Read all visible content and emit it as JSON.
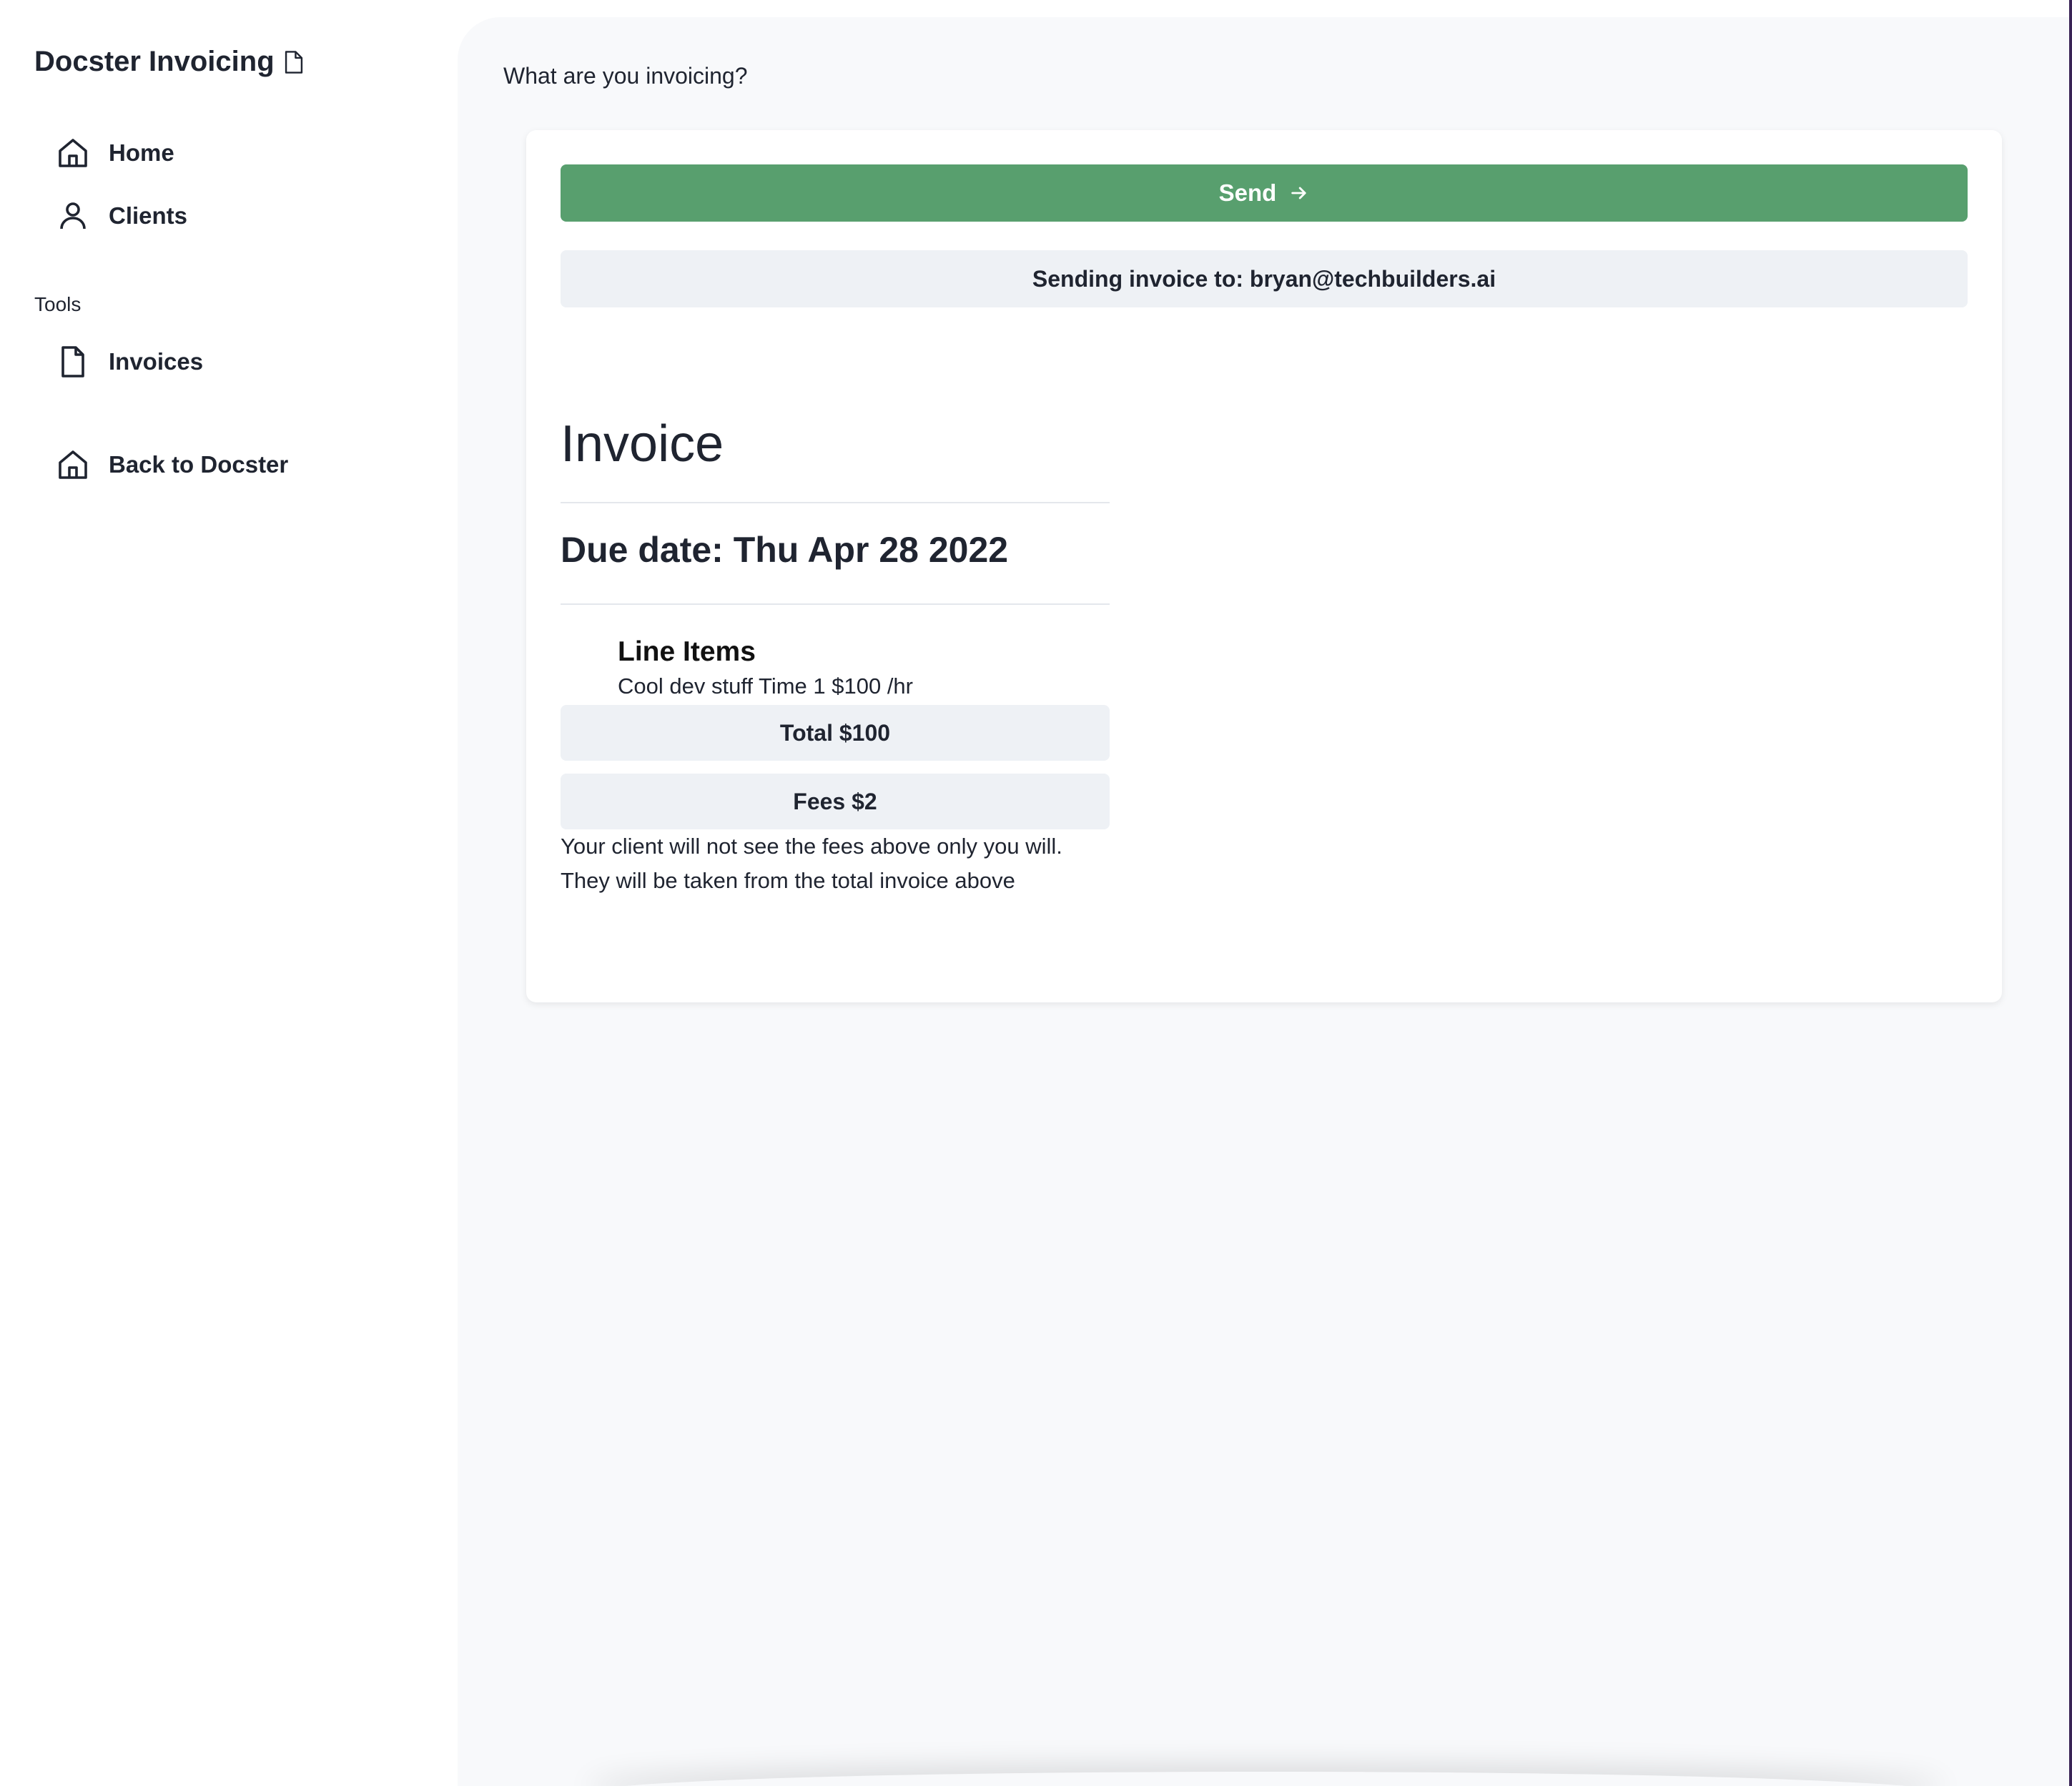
{
  "app": {
    "brand": "Docster Invoicing",
    "brand_icon": "document-icon"
  },
  "sidebar": {
    "items": [
      {
        "label": "Home",
        "icon": "home-icon"
      },
      {
        "label": "Clients",
        "icon": "user-icon"
      }
    ],
    "section_label": "Tools",
    "tools": [
      {
        "label": "Invoices",
        "icon": "document-icon"
      }
    ],
    "back": {
      "label": "Back to Docster",
      "icon": "home-icon"
    }
  },
  "main": {
    "prompt": "What are you invoicing?",
    "send_label": "Send",
    "sending_to": "Sending invoice to: bryan@techbuilders.ai",
    "invoice": {
      "title": "Invoice",
      "due_date": "Due date: Thu Apr 28 2022",
      "line_items_heading": "Line Items",
      "line_items": [
        "Cool dev stuff Time 1 $100 /hr"
      ],
      "total": "Total $100",
      "fees": "Fees $2",
      "note_line1": "Your client will not see the fees above only you will.",
      "note_line2": "They will be taken from the total invoice above"
    }
  },
  "colors": {
    "accent": "#589f6e",
    "pill_bg": "#eef1f5",
    "main_bg": "#f8f9fb"
  }
}
